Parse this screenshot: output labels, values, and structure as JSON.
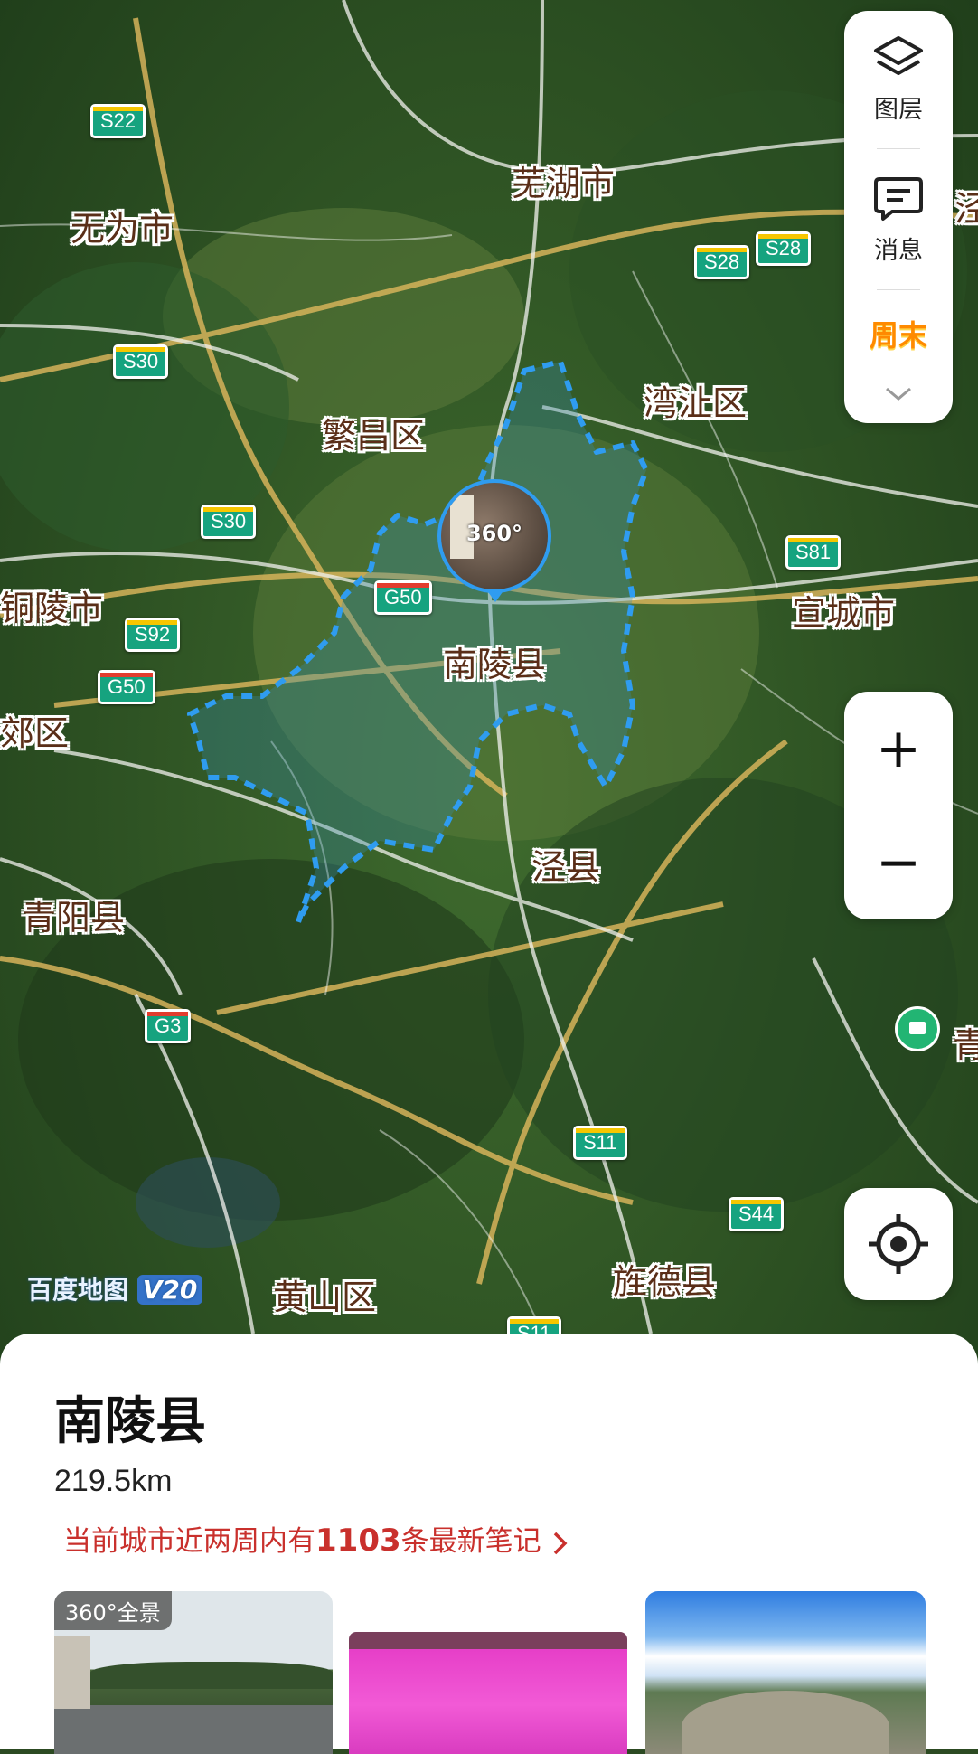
{
  "map": {
    "watermark": "百度地图",
    "watermark_version": "V20",
    "selected_marker": {
      "badge": "360°",
      "label": "南陵县"
    },
    "places": [
      {
        "id": "wuhu",
        "name": "芜湖市"
      },
      {
        "id": "wuwei",
        "name": "无为市"
      },
      {
        "id": "fanchang",
        "name": "繁昌区"
      },
      {
        "id": "wanzhi",
        "name": "湾沚区"
      },
      {
        "id": "tongling",
        "name": "铜陵市"
      },
      {
        "id": "xuancheng",
        "name": "宣城市"
      },
      {
        "id": "jiaoqu",
        "name": "郊区"
      },
      {
        "id": "jingxian",
        "name": "泾县"
      },
      {
        "id": "qingyang",
        "name": "青阳县"
      },
      {
        "id": "huangshanqu",
        "name": "黄山区"
      },
      {
        "id": "jingdexian",
        "name": "旌德县"
      },
      {
        "id": "edge_right_top",
        "name": "泾"
      },
      {
        "id": "edge_right_poi",
        "name": "青"
      }
    ],
    "road_shields": [
      {
        "id": "s22",
        "label": "S22",
        "kind": "s"
      },
      {
        "id": "s28a",
        "label": "S28",
        "kind": "s"
      },
      {
        "id": "s28b",
        "label": "S28",
        "kind": "s"
      },
      {
        "id": "s30a",
        "label": "S30",
        "kind": "s"
      },
      {
        "id": "s30b",
        "label": "S30",
        "kind": "s"
      },
      {
        "id": "s81",
        "label": "S81",
        "kind": "s"
      },
      {
        "id": "g50a",
        "label": "G50",
        "kind": "g"
      },
      {
        "id": "s92",
        "label": "S92",
        "kind": "s"
      },
      {
        "id": "g50b",
        "label": "G50",
        "kind": "g"
      },
      {
        "id": "g3",
        "label": "G3",
        "kind": "g"
      },
      {
        "id": "s11a",
        "label": "S11",
        "kind": "s"
      },
      {
        "id": "s44",
        "label": "S44",
        "kind": "s"
      },
      {
        "id": "s11b",
        "label": "S11",
        "kind": "s"
      }
    ]
  },
  "toolbar": {
    "layers_label": "图层",
    "messages_label": "消息",
    "weekend_label": "周末"
  },
  "zoom": {
    "in_label": "+",
    "out_label": "−"
  },
  "sheet": {
    "title": "南陵县",
    "distance": "219.5km",
    "notes_prefix": "当前城市近两周内有",
    "notes_count": "1103",
    "notes_suffix": "条最新笔记",
    "thumb_badge": "360°全景"
  },
  "colors": {
    "accent_red": "#c9302c",
    "region_outline": "#2f9cf0",
    "road_shield_green": "#16a37f"
  }
}
